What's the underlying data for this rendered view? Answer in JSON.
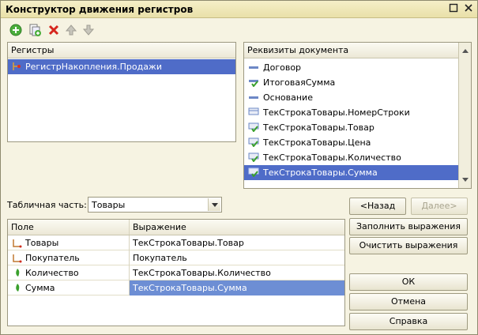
{
  "window": {
    "title": "Конструктор движения регистров"
  },
  "toolbar": {
    "add_icon": "add-icon",
    "copy_icon": "copy-icon",
    "delete_icon": "delete-icon",
    "up_icon": "arrow-up-icon",
    "down_icon": "arrow-down-icon"
  },
  "registers": {
    "header": "Регистры",
    "items": [
      {
        "label": "РегистрНакопления.Продажи"
      }
    ]
  },
  "attributes": {
    "header": "Реквизиты документа",
    "items": [
      {
        "label": "Договор"
      },
      {
        "label": "ИтоговаяСумма"
      },
      {
        "label": "Основание"
      },
      {
        "label": "ТекСтрокаТовары.НомерСтроки"
      },
      {
        "label": "ТекСтрокаТовары.Товар"
      },
      {
        "label": "ТекСтрокаТовары.Цена"
      },
      {
        "label": "ТекСтрокаТовары.Количество"
      },
      {
        "label": "ТекСтрокаТовары.Сумма"
      }
    ]
  },
  "tabular": {
    "label": "Табличная часть:",
    "value": "Товары"
  },
  "nav": {
    "back": "<Назад",
    "next": "Далее>"
  },
  "grid": {
    "col_field": "Поле",
    "col_expr": "Выражение",
    "rows": [
      {
        "field": "Товары",
        "expr": "ТекСтрокаТовары.Товар"
      },
      {
        "field": "Покупатель",
        "expr": "Покупатель"
      },
      {
        "field": "Количество",
        "expr": "ТекСтрокаТовары.Количество"
      },
      {
        "field": "Сумма",
        "expr": "ТекСтрокаТовары.Сумма"
      }
    ]
  },
  "buttons": {
    "fill": "Заполнить выражения",
    "clear": "Очистить выражения",
    "ok": "ОК",
    "cancel": "Отмена",
    "help": "Справка"
  }
}
